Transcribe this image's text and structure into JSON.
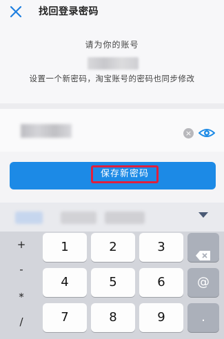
{
  "header": {
    "title": "找回登录密码"
  },
  "content": {
    "line1": "请为你的账号",
    "line2": "设置一个新密码，淘宝账号的密码也同步修改"
  },
  "form": {
    "clear_label": "×"
  },
  "actions": {
    "save_label": "保存新密码"
  },
  "keyboard": {
    "symbols": [
      "+",
      "-",
      "*",
      "/"
    ],
    "rows": [
      [
        "1",
        "2",
        "3"
      ],
      [
        "4",
        "5",
        "6"
      ],
      [
        "7",
        "8",
        "9"
      ]
    ],
    "side_keys": [
      "⌫",
      "@",
      "."
    ]
  },
  "colors": {
    "accent": "#1c8ae6",
    "highlight_border": "#e0203c"
  }
}
